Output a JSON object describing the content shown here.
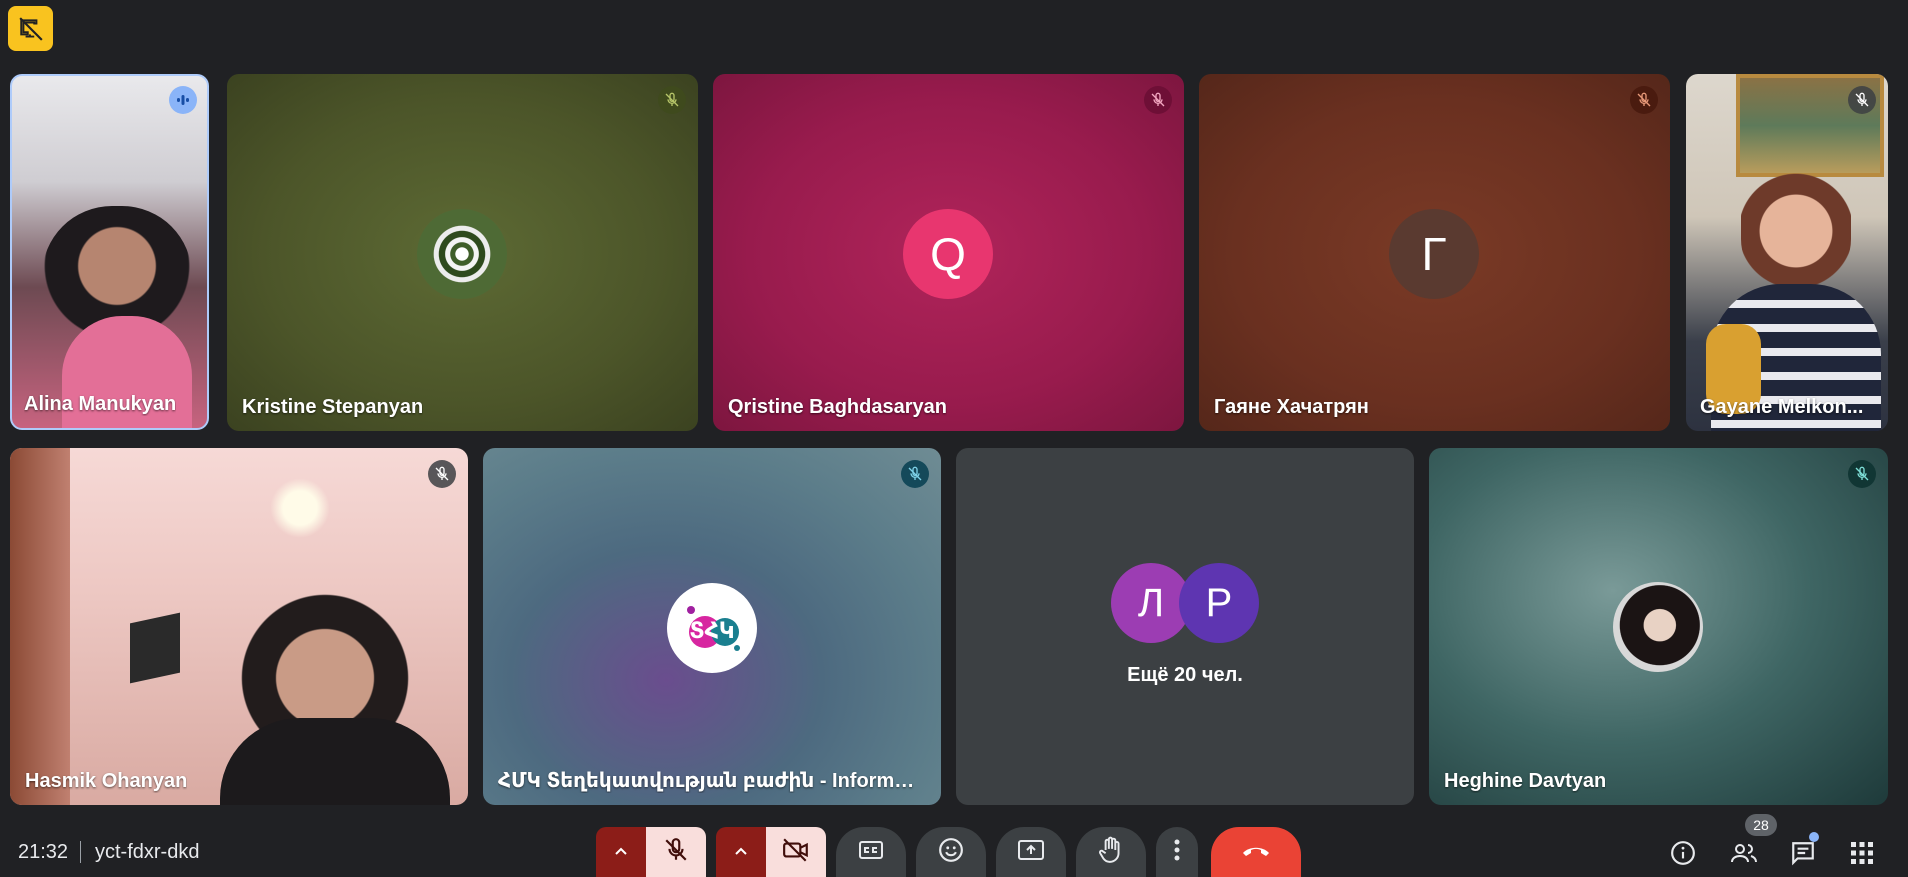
{
  "participants": [
    {
      "name": "Alina Manukyan",
      "speaking": true
    },
    {
      "name": "Kristine Stepanyan",
      "muted": true
    },
    {
      "name": "Qristine Baghdasaryan",
      "initial": "Q",
      "muted": true
    },
    {
      "name": "Гаяне Хачатрян",
      "initial": "Г",
      "muted": true
    },
    {
      "name": "Gayane Melkon...",
      "muted": true
    },
    {
      "name": "Hasmik Ohanyan",
      "muted": true
    },
    {
      "name": "ՀՄԿ Տեղեկատվության բաժին - Informati...",
      "muted": true
    },
    {
      "name": "Heghine Davtyan",
      "muted": true
    }
  ],
  "more_tile": {
    "initials": [
      "Л",
      "Р"
    ],
    "label": "Ещё 20 чел."
  },
  "bottom_bar": {
    "time": "21:32",
    "meeting_code": "yct-fdxr-dkd",
    "people_count": "28"
  },
  "colors": {
    "background": "#202124",
    "end_call": "#ea4335",
    "accent": "#8ab4f8",
    "pin_badge": "#f9c31f"
  },
  "icons": [
    "no-video-pin-icon",
    "speaking-icon",
    "mic-off-icon",
    "chevron-up-icon",
    "video-off-icon",
    "captions-icon",
    "emoji-icon",
    "present-icon",
    "raise-hand-icon",
    "more-icon",
    "end-call-icon",
    "info-icon",
    "people-icon",
    "chat-icon",
    "activities-icon"
  ]
}
